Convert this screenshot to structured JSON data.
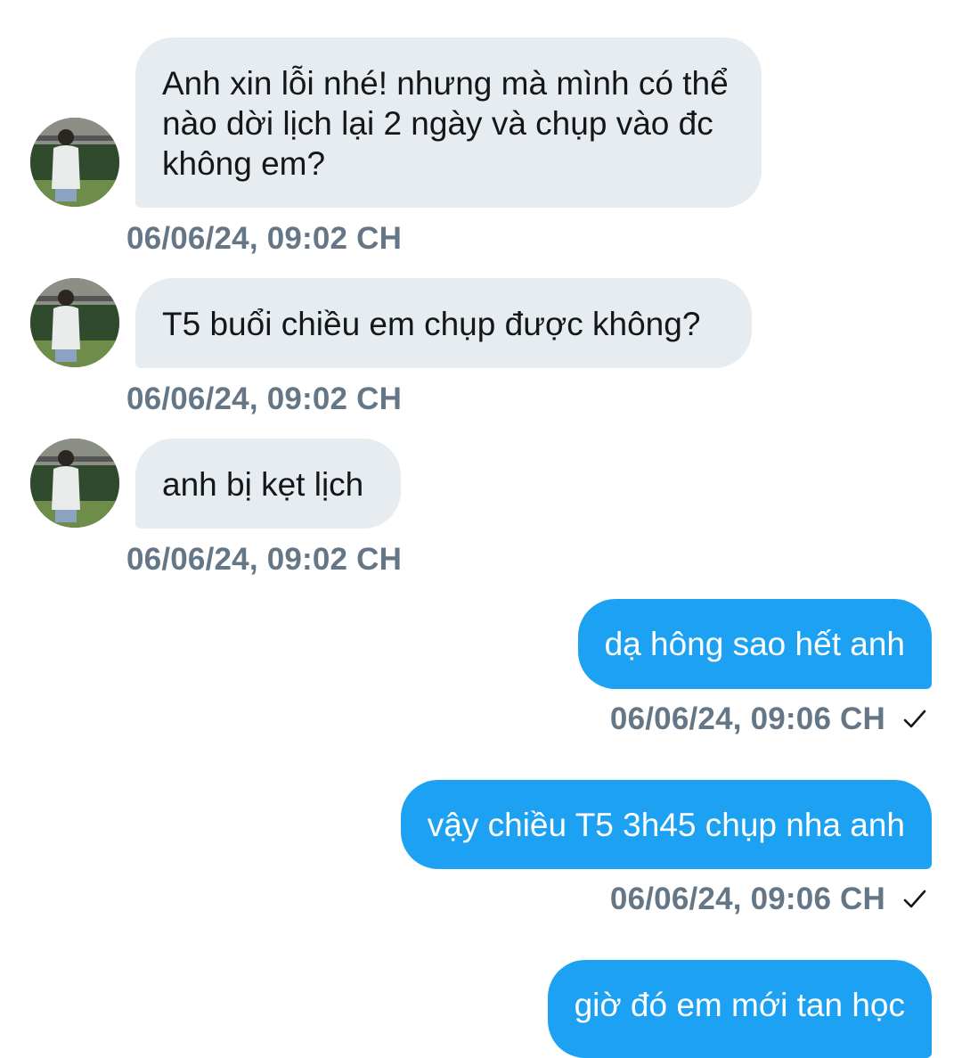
{
  "messages": [
    {
      "direction": "in",
      "text": "Anh xin lỗi nhé! nhưng mà mình có thể nào dời lịch lại 2 ngày và chụp vào đc không em?",
      "timestamp": "06/06/24, 09:02 CH"
    },
    {
      "direction": "in",
      "text": "T5 buổi chiều em chụp được không?",
      "timestamp": "06/06/24, 09:02 CH"
    },
    {
      "direction": "in",
      "text": "anh bị kẹt lịch",
      "timestamp": "06/06/24, 09:02 CH"
    },
    {
      "direction": "out",
      "text": "dạ hông sao hết anh",
      "timestamp": "06/06/24, 09:06 CH",
      "status_icon": "checkmark-icon"
    },
    {
      "direction": "out",
      "text": "vậy chiều T5 3h45 chụp nha anh",
      "timestamp": "06/06/24, 09:06 CH",
      "status_icon": "checkmark-icon"
    },
    {
      "direction": "out",
      "text": "giờ đó em mới tan học"
    }
  ],
  "colors": {
    "incoming_bubble": "#e6ecf0",
    "outgoing_bubble": "#1da1f2",
    "timestamp": "#657786"
  }
}
